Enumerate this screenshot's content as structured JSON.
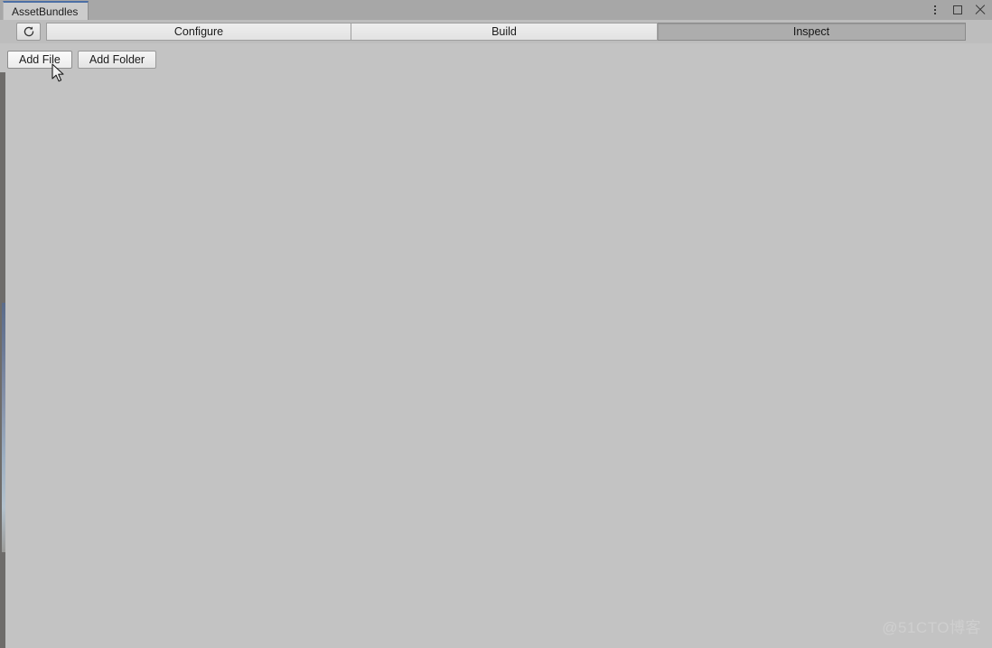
{
  "window": {
    "tab_label": "AssetBundles",
    "controls": {
      "menu_label": "⋮",
      "maximize_label": "",
      "close_label": ""
    }
  },
  "toolbar": {
    "refresh_icon": "refresh-icon",
    "tabs": [
      {
        "label": "Configure",
        "selected": false
      },
      {
        "label": "Build",
        "selected": false
      },
      {
        "label": "Inspect",
        "selected": true
      }
    ]
  },
  "actions": {
    "add_file_label": "Add File",
    "add_folder_label": "Add Folder"
  },
  "content": {
    "items": [],
    "empty_text": ""
  },
  "watermark": {
    "text": "@51CTO博客"
  },
  "colors": {
    "window_bg": "#c3c3c3",
    "titlebar_bg": "#a7a7a7",
    "toolbar_bg": "#bdbdbd",
    "tab_accent": "#4c6fa5",
    "selected_tab_bg": "#adadad",
    "button_face": "#eeeeee",
    "border": "#9a9a9a",
    "edge_strip": "#6b7a98"
  }
}
